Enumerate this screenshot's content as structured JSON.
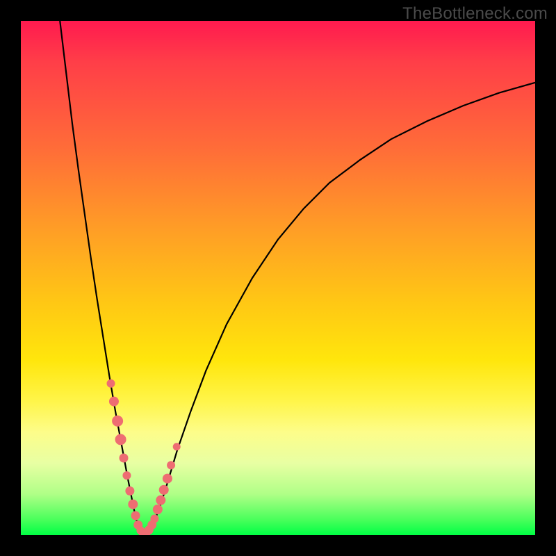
{
  "watermark": "TheBottleneck.com",
  "chart_data": {
    "type": "line",
    "title": "",
    "xlabel": "",
    "ylabel": "",
    "xlim": [
      0,
      100
    ],
    "ylim": [
      0,
      100
    ],
    "series": [
      {
        "name": "bottleneck-curve",
        "color": "#000000",
        "x": [
          7.6,
          8.8,
          10.0,
          11.2,
          12.4,
          13.6,
          14.8,
          16.0,
          17.2,
          18.4,
          19.6,
          20.8,
          21.4,
          22.0,
          22.6,
          23.2,
          24.0,
          25.0,
          26.0,
          27.2,
          28.6,
          30.4,
          33.0,
          36.0,
          40.0,
          45.0,
          50.0,
          55.0,
          60.0,
          66.0,
          72.0,
          79.0,
          86.0,
          93.0,
          100.0
        ],
        "y": [
          100.0,
          90.0,
          80.0,
          71.0,
          62.5,
          54.0,
          46.0,
          38.5,
          31.0,
          24.0,
          17.5,
          11.0,
          8.0,
          5.0,
          2.5,
          0.8,
          0.2,
          0.8,
          2.8,
          6.0,
          10.5,
          16.5,
          24.0,
          32.0,
          41.0,
          50.0,
          57.5,
          63.5,
          68.5,
          73.0,
          77.0,
          80.5,
          83.5,
          86.0,
          88.0
        ]
      }
    ],
    "markers": [
      {
        "x": 17.5,
        "y": 29.5,
        "r": 6
      },
      {
        "x": 18.1,
        "y": 26.0,
        "r": 7
      },
      {
        "x": 18.8,
        "y": 22.2,
        "r": 8
      },
      {
        "x": 19.4,
        "y": 18.6,
        "r": 8
      },
      {
        "x": 20.0,
        "y": 15.0,
        "r": 6.5
      },
      {
        "x": 20.6,
        "y": 11.6,
        "r": 6
      },
      {
        "x": 21.2,
        "y": 8.6,
        "r": 6.5
      },
      {
        "x": 21.8,
        "y": 6.0,
        "r": 7
      },
      {
        "x": 22.3,
        "y": 3.8,
        "r": 6.5
      },
      {
        "x": 22.8,
        "y": 2.0,
        "r": 6.5
      },
      {
        "x": 23.3,
        "y": 0.9,
        "r": 6
      },
      {
        "x": 23.8,
        "y": 0.3,
        "r": 6
      },
      {
        "x": 24.4,
        "y": 0.4,
        "r": 6
      },
      {
        "x": 24.9,
        "y": 1.0,
        "r": 6.5
      },
      {
        "x": 25.5,
        "y": 2.0,
        "r": 6.5
      },
      {
        "x": 26.0,
        "y": 3.2,
        "r": 6
      },
      {
        "x": 26.6,
        "y": 5.0,
        "r": 7
      },
      {
        "x": 27.2,
        "y": 6.8,
        "r": 7
      },
      {
        "x": 27.8,
        "y": 8.8,
        "r": 7
      },
      {
        "x": 28.5,
        "y": 11.0,
        "r": 7
      },
      {
        "x": 29.2,
        "y": 13.6,
        "r": 6
      },
      {
        "x": 30.3,
        "y": 17.2,
        "r": 5.5
      }
    ],
    "marker_color": "#ee6d72",
    "gradient_stops": [
      {
        "pos": 0.0,
        "color": "#ff1a4f"
      },
      {
        "pos": 0.5,
        "color": "#ffc400"
      },
      {
        "pos": 0.8,
        "color": "#fff85a"
      },
      {
        "pos": 1.0,
        "color": "#00ff44"
      }
    ]
  }
}
